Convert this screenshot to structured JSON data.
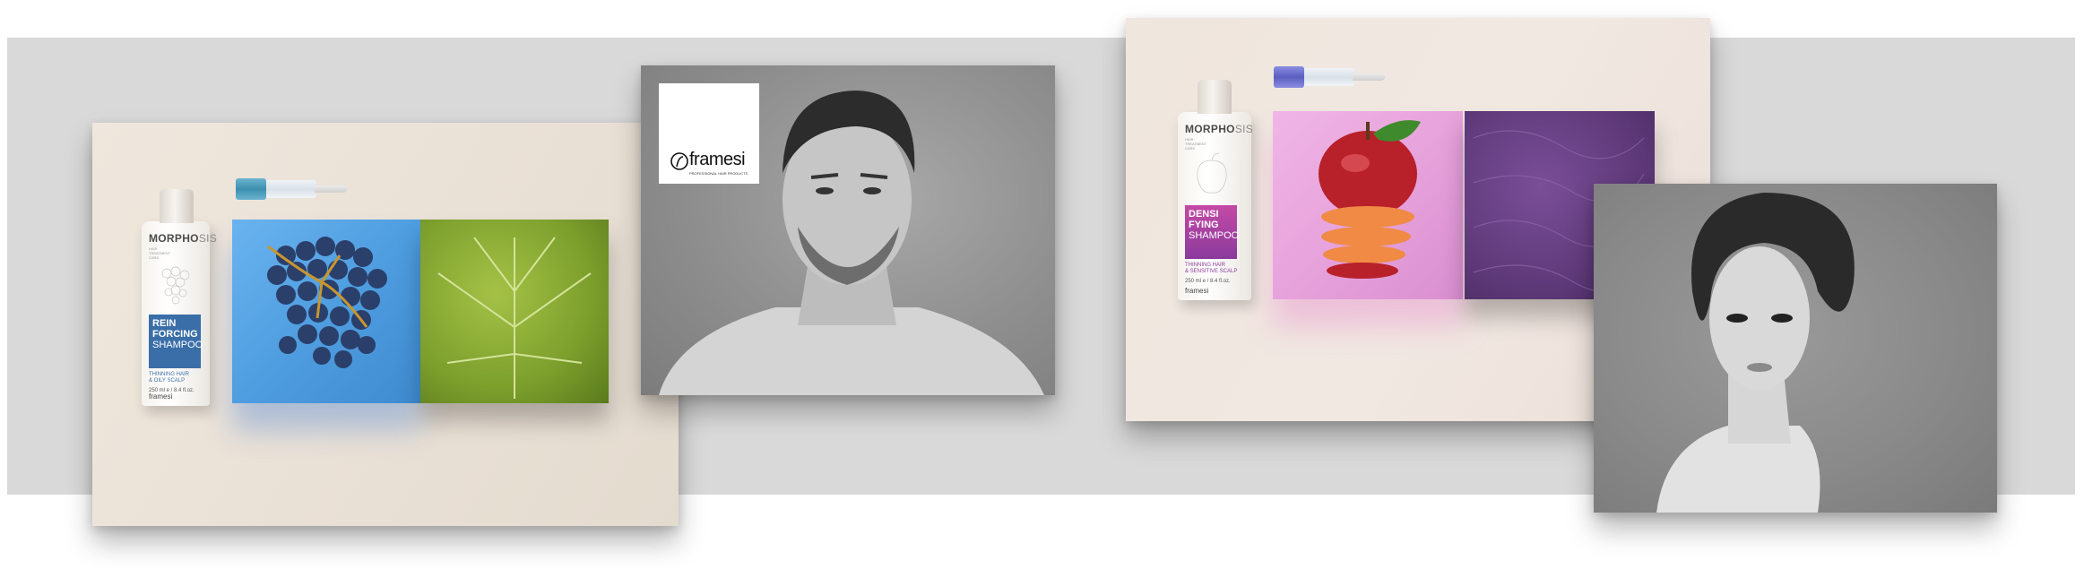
{
  "products": [
    {
      "brand_main": "MORPHO",
      "brand_end": "SIS",
      "subtitle": "HAIR TREATMENT CARE",
      "name_line1": "REIN",
      "name_line2": "FORCING",
      "type": "SHAMPOO",
      "use_line1": "THINNING HAIR",
      "use_line2": "& OILY SCALP",
      "size": "250 ml e / 8.4 fl.oz.",
      "maker": "framesi",
      "label_color": "#3a6ea8",
      "vial_cap_color": "#3d8fb0"
    },
    {
      "brand_main": "MORPHO",
      "brand_end": "SIS",
      "subtitle": "HAIR TREATMENT CARE",
      "name_line1": "DENSI",
      "name_line2": "FYING",
      "type": "SHAMPOO",
      "use_line1": "THINNING HAIR",
      "use_line2": "& SENSITIVE SCALP",
      "size": "250 ml e / 8.4 fl.oz.",
      "maker": "framesi",
      "label_color": "#a23c9c",
      "vial_cap_color": "#5c5ec0"
    }
  ],
  "logo": {
    "name": "framesi",
    "tagline": "PROFESSIONAL HAIR PRODUCTS"
  },
  "colors": {
    "blue_box": "#4f9ee0",
    "leaf_green": "#7c9f2c",
    "pink_box": "#e7a3dc",
    "purple_box": "#5f3a7a"
  }
}
